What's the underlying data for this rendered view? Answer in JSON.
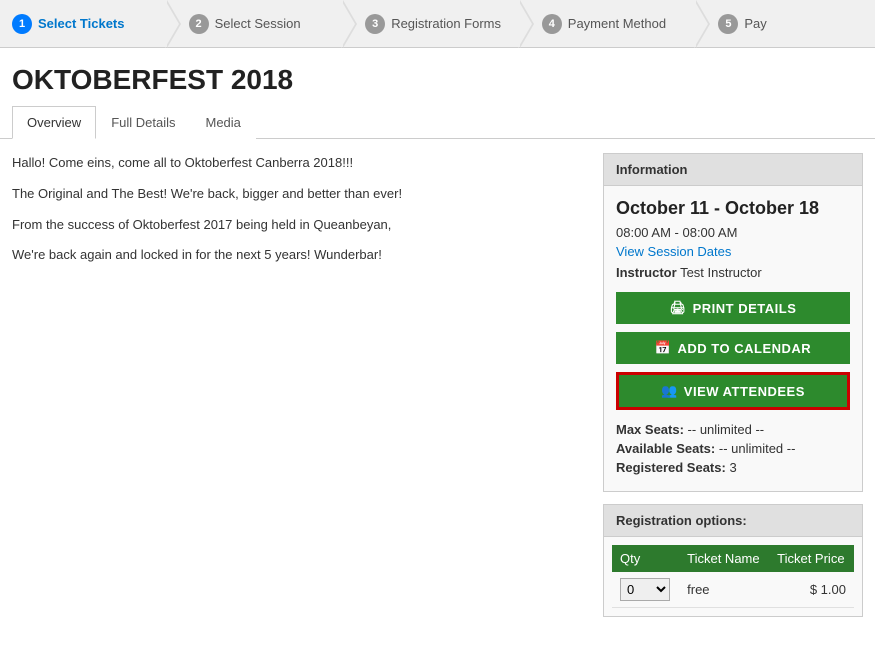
{
  "wizard": {
    "steps": [
      {
        "num": "1",
        "label": "Select Tickets",
        "active": true
      },
      {
        "num": "2",
        "label": "Select Session",
        "active": false
      },
      {
        "num": "3",
        "label": "Registration Forms",
        "active": false
      },
      {
        "num": "4",
        "label": "Payment Method",
        "active": false
      },
      {
        "num": "5",
        "label": "Pay",
        "active": false
      }
    ]
  },
  "page": {
    "title": "OKTOBERFEST 2018"
  },
  "tabs": [
    {
      "label": "Overview",
      "active": true
    },
    {
      "label": "Full Details",
      "active": false
    },
    {
      "label": "Media",
      "active": false
    }
  ],
  "description": {
    "p1": "Hallo! Come eins, come all to Oktoberfest Canberra 2018!!!",
    "p2": "The Original and The Best! We're back, bigger and better than ever!",
    "p3": "From the success of Oktoberfest 2017 being held in Queanbeyan,",
    "p4": "We're back again and locked in for the next 5 years! Wunderbar!"
  },
  "info": {
    "header": "Information",
    "date": "October 11 - October 18",
    "time": "08:00 AM - 08:00 AM",
    "view_session_link": "View Session Dates",
    "instructor_label": "Instructor",
    "instructor_name": "Test Instructor",
    "btn_print": "PRINT DETAILS",
    "btn_calendar": "ADD TO CALENDAR",
    "btn_attendees": "VIEW ATTENDEES",
    "max_seats_label": "Max Seats:",
    "max_seats_value": "-- unlimited --",
    "available_seats_label": "Available Seats:",
    "available_seats_value": "-- unlimited --",
    "registered_seats_label": "Registered Seats:",
    "registered_seats_value": "3"
  },
  "registration": {
    "header": "Registration options:",
    "table": {
      "col_qty": "Qty",
      "col_name": "Ticket Name",
      "col_price": "Ticket Price",
      "rows": [
        {
          "qty": "0",
          "name": "free",
          "price": "$ 1.00"
        }
      ]
    }
  }
}
